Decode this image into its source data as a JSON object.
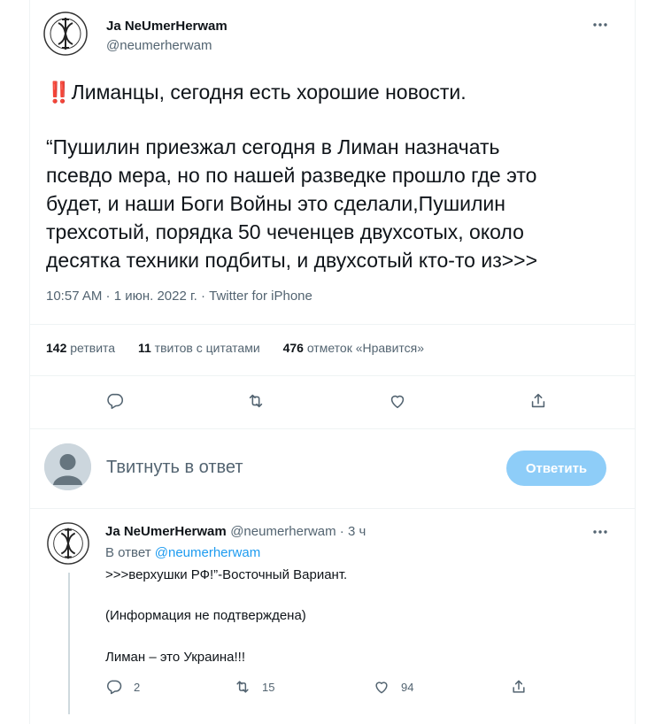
{
  "main_tweet": {
    "display_name": "Ja NeUmerHerwam",
    "handle": "@neumerherwam",
    "emoji": "‼️",
    "first_line": "Лиманцы, сегодня есть хорошие новости.",
    "body_lines": [
      "“Пушилин  приезжал сегодня в Лиман назначать",
      "псевдо мера, но по нашей разведке прошло где это",
      "будет, и наши Боги Войны это сделали,Пушилин",
      "трехсотый, порядка 50 чеченцев двухсотых, около",
      "десятка техники подбиты, и двухсотый кто-то из>>>"
    ],
    "meta": "10:57 AM · 1 июн. 2022 г. · Twitter for iPhone",
    "stats": {
      "retweets_count": "142",
      "retweets_label": "ретвита",
      "quotes_count": "11",
      "quotes_label": "твитов с цитатами",
      "likes_count": "476",
      "likes_label": "отметок «Нравится»"
    }
  },
  "reply_composer": {
    "placeholder": "Твитнуть в ответ",
    "button_label": "Ответить"
  },
  "reply_tweet": {
    "display_name": "Ja NeUmerHerwam",
    "handle_time": "@neumerherwam · 3 ч",
    "replying_prefix": "В ответ",
    "replying_to": "@neumerherwam",
    "lines": [
      ">>>верхушки РФ!”-Восточный Вариант.",
      "(Информация не подтверждена)",
      "Лиман – это Украина!!!"
    ],
    "counts": {
      "replies": "2",
      "retweets": "15",
      "likes": "94"
    }
  },
  "icons": {
    "reply": "reply-icon",
    "retweet": "retweet-icon",
    "like": "heart-icon",
    "share": "share-icon",
    "more": "more-icon"
  },
  "colors": {
    "accent": "#1d9bf0",
    "button_disabled": "#8ecdf8",
    "secondary_text": "#536471"
  }
}
